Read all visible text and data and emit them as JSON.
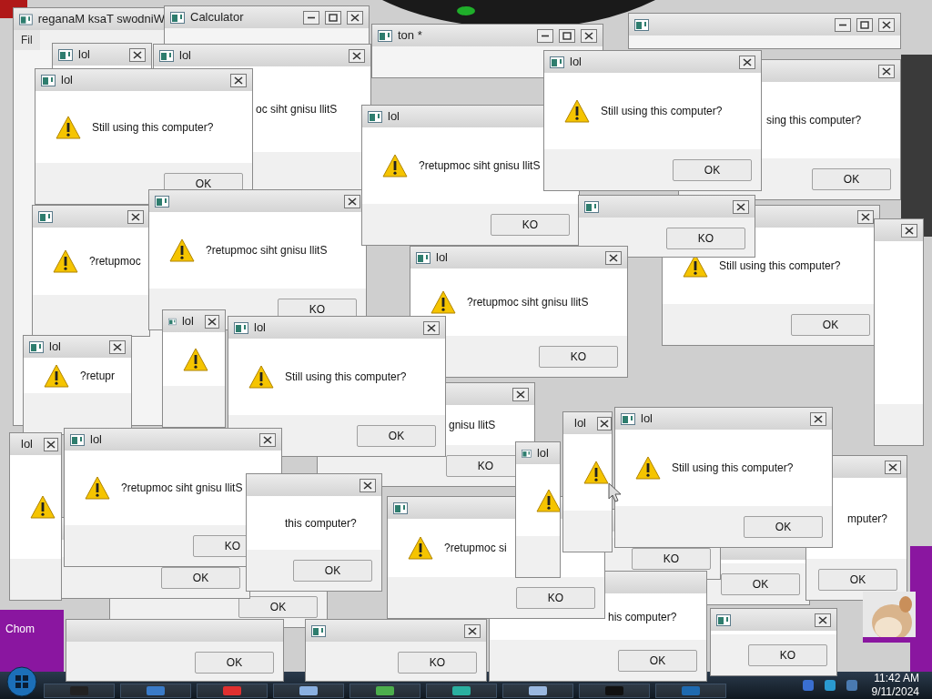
{
  "desktop": {
    "icon_label": "Chom"
  },
  "windows": [
    {
      "kind": "app",
      "title": "reganaM ksaT swodniW",
      "menu": "Fil"
    },
    {
      "kind": "app",
      "title": "Calculator"
    },
    {
      "kind": "app",
      "title": "ton *"
    },
    {
      "kind": "app"
    },
    {
      "kind": "dialog",
      "title": "lol",
      "icon": false
    },
    {
      "kind": "dialog",
      "title": "lol",
      "icon": false,
      "message": "oc siht gnisu llitS"
    },
    {
      "kind": "dialog",
      "title": "lol",
      "icon": true,
      "message": "Still using this computer?",
      "button": "OK"
    },
    {
      "kind": "dialog",
      "icon": true,
      "message": "?retupmoc"
    },
    {
      "kind": "dialog",
      "icon": true,
      "message": "?retupmoc siht gnisu llitS",
      "button": "KO"
    },
    {
      "kind": "dialog",
      "title": "lol",
      "icon": true,
      "message": "?retupmoc siht gnisu llitS",
      "button": "KO"
    },
    {
      "kind": "dialog",
      "icon": false,
      "message": "sing this computer?",
      "button": "OK"
    },
    {
      "kind": "dialog",
      "icon": true,
      "message": "Still using this computer?",
      "button": "OK"
    },
    {
      "kind": "dialog",
      "title": "lol",
      "icon": true,
      "message": "Still using this computer?",
      "button": "OK"
    },
    {
      "kind": "dialog",
      "icon": false,
      "button": "KO"
    },
    {
      "kind": "dialog",
      "icon": false
    },
    {
      "kind": "dialog",
      "title": "lol",
      "icon": true,
      "message": "?retupmoc siht gnisu llitS",
      "button": "KO"
    },
    {
      "kind": "dialog",
      "title": "lol",
      "icon": true,
      "message": "?retupr"
    },
    {
      "kind": "dialog",
      "title": "lol",
      "icon": true
    },
    {
      "kind": "dialog",
      "icon": false,
      "message": "gnisu llitS",
      "button": "KO"
    },
    {
      "kind": "dialog",
      "title": "lol",
      "icon": true,
      "message": "Still using this computer?",
      "button": "OK"
    },
    {
      "kind": "dialog",
      "icon": false,
      "button": "OK"
    },
    {
      "kind": "dialog",
      "icon": false,
      "button": "OK"
    },
    {
      "kind": "dialog",
      "icon": false,
      "button": "OK"
    },
    {
      "kind": "dialog",
      "title": "lol",
      "icon": true
    },
    {
      "kind": "dialog",
      "title": "lol",
      "icon": true,
      "message": "?retupmoc siht gnisu llitS",
      "button": "KO"
    },
    {
      "kind": "dialog",
      "icon": false,
      "message": "this computer?",
      "button": "OK"
    },
    {
      "kind": "dialog",
      "icon": false,
      "button": "OK"
    },
    {
      "kind": "dialog",
      "icon": false,
      "button": "KO"
    },
    {
      "kind": "dialog",
      "icon": false,
      "message": "his computer?",
      "button": "OK"
    },
    {
      "kind": "dialog",
      "icon": true,
      "message": "?retupmoc si",
      "button": "KO"
    },
    {
      "kind": "dialog",
      "icon": false,
      "button": "KO"
    },
    {
      "kind": "dialog",
      "title": "lol",
      "icon": true
    },
    {
      "kind": "dialog",
      "title": "lol",
      "icon": true
    },
    {
      "kind": "dialog",
      "icon": false,
      "button": "KO"
    },
    {
      "kind": "dialog",
      "icon": false,
      "message": "mputer?",
      "button": "OK"
    },
    {
      "kind": "dialog",
      "title": "lol",
      "icon": true,
      "message": "Still using this computer?",
      "button": "OK"
    }
  ],
  "clock": {
    "time": "11:42 AM",
    "date": "9/11/2024"
  }
}
